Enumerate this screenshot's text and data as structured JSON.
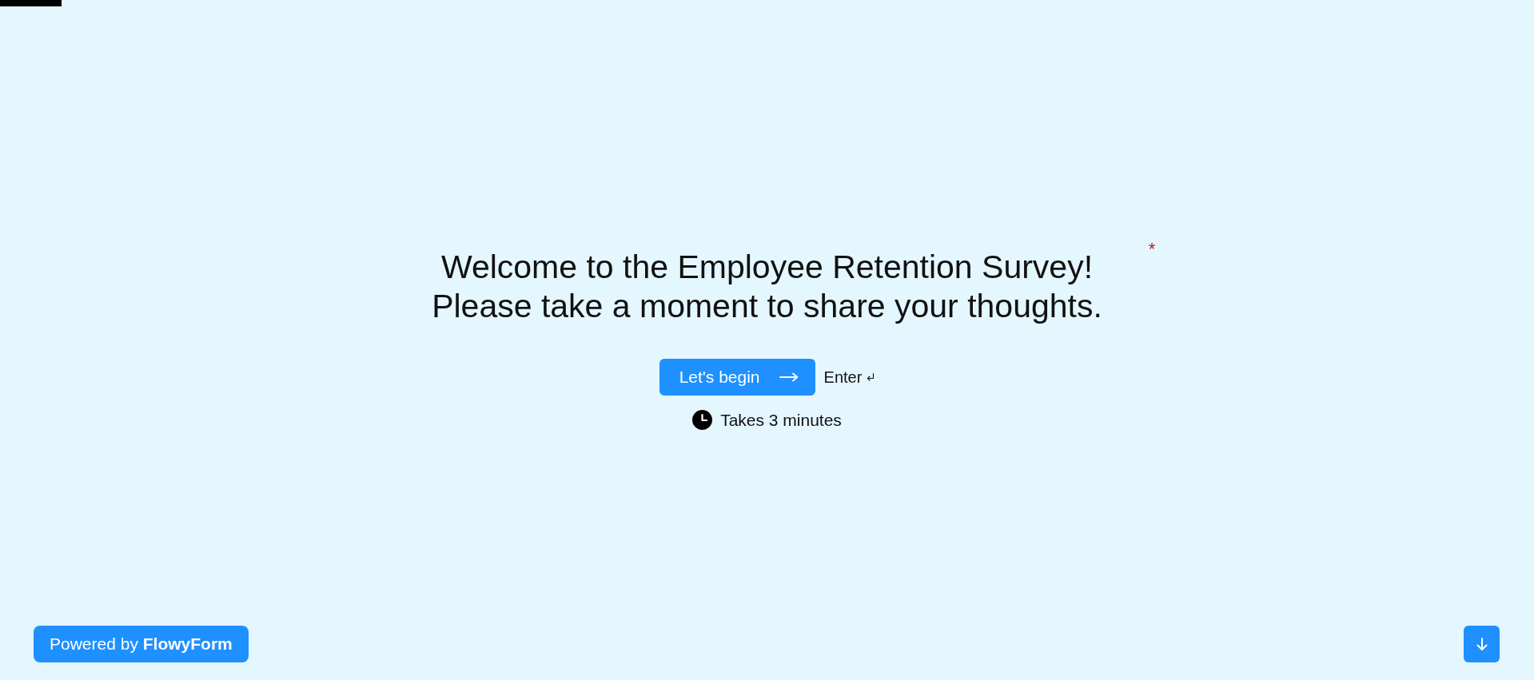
{
  "progress": {
    "level": 0.04
  },
  "welcome": {
    "title_lines": [
      "Welcome to the Employee Retention Survey!",
      "Please take a moment to share your thoughts."
    ],
    "required_mark": "*"
  },
  "start_button": {
    "label": "Let's begin"
  },
  "enter_hint": {
    "label": "Enter"
  },
  "duration": "Takes 3 minutes",
  "branding": "Powered by **FlowyForm**"
}
